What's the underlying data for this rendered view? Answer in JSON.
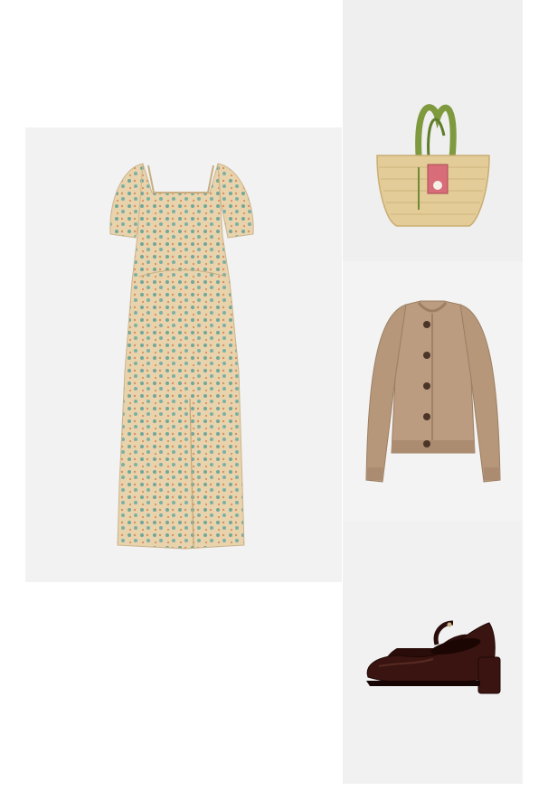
{
  "outfit": {
    "items": [
      {
        "id": "dress",
        "name": "",
        "icon": "floral-midi-dress"
      },
      {
        "id": "bag",
        "name": "",
        "icon": "straw-basket-bag"
      },
      {
        "id": "cardigan",
        "name": "",
        "icon": "knit-cardigan"
      },
      {
        "id": "shoes",
        "name": "",
        "icon": "mary-jane-heels"
      }
    ]
  },
  "colors": {
    "tile_bg": "#f2f2f2",
    "dress_base": "#e6cfa6",
    "dress_print_teal": "#6fa79a",
    "dress_print_orange": "#d98f5e",
    "bag_straw": "#e3cc98",
    "bag_handle": "#7f9a3e",
    "bag_patch": "#d86c78",
    "cardigan": "#b6977a",
    "cardigan_buttons": "#4b3528",
    "shoes": "#3a1410"
  }
}
